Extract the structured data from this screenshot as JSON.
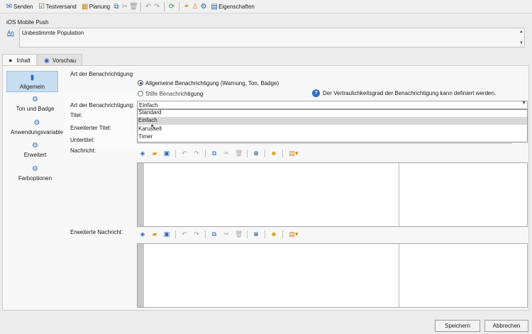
{
  "toolbar": {
    "send": "Senden",
    "test_send": "Testversand",
    "planning": "Planung",
    "properties": "Eigenschaften"
  },
  "header": {
    "title": "iOS Mobile Push",
    "target_link": "An",
    "population": "Unbestimmte Population"
  },
  "tabs": {
    "content": "Inhalt",
    "preview": "Vorschau"
  },
  "nav": {
    "general": "Allgemein",
    "sound_badge": "Ton und Badge",
    "app_variables": "Anwendungsvariable",
    "advanced": "Erweitert",
    "color_options": "Farboptionen"
  },
  "form": {
    "section_title": "Art der Benachrichtigung",
    "radio_general": "Allgemeine Benachrichtigung (Warnung, Ton, Badge)",
    "radio_silent": "Stille Benachrichtigung",
    "confidentiality_note": "Der Vertraulichkeitsgrad der Benachrichtigung kann definiert werden.",
    "type_label": "Art der Benachrichtigung:",
    "type_value": "Einfach",
    "title_label": "Titel:",
    "extended_title_label": "Erweiterter Titel:",
    "subtitle_label": "Untertitel:",
    "message_label": "Nachricht:",
    "extended_message_label": "Erweiterte Nachricht:",
    "options": [
      "Standard",
      "Einfach",
      "Karussell",
      "Timer"
    ]
  },
  "footer": {
    "save": "Speichern",
    "cancel": "Abbrechen"
  }
}
